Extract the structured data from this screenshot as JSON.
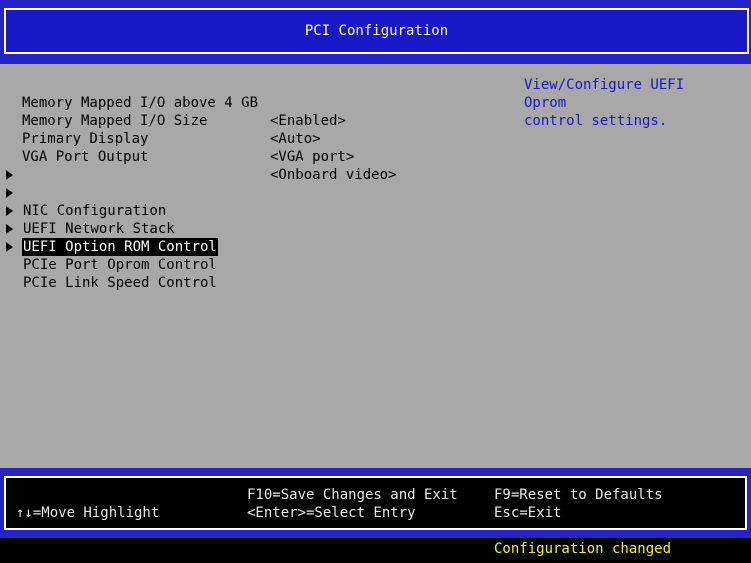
{
  "header": {
    "title": "PCI Configuration"
  },
  "settings": [
    {
      "label": "Memory Mapped I/O above 4 GB",
      "value": "<Enabled>"
    },
    {
      "label": "Memory Mapped I/O Size",
      "value": "<Auto>"
    },
    {
      "label": "Primary Display",
      "value": "<VGA port>"
    },
    {
      "label": "VGA Port Output",
      "value": "<Onboard video>"
    }
  ],
  "submenus": [
    {
      "label": "NIC Configuration",
      "selected": false
    },
    {
      "label": "UEFI Network Stack",
      "selected": false
    },
    {
      "label": "UEFI Option ROM Control",
      "selected": true
    },
    {
      "label": "PCIe Port Oprom Control",
      "selected": false
    },
    {
      "label": "PCIe Link Speed Control",
      "selected": false
    }
  ],
  "help": {
    "text": "View/Configure UEFI Oprom\ncontrol settings."
  },
  "footer": {
    "move_highlight": "↑↓=Move Highlight",
    "save_exit": "F10=Save Changes and Exit",
    "select_entry": "<Enter>=Select Entry",
    "reset_defaults": "F9=Reset to Defaults",
    "esc_exit": "Esc=Exit"
  },
  "status": {
    "message": "Configuration changed"
  },
  "colors": {
    "frame_blue": "#2424c8",
    "panel_gray": "#a8a8a8",
    "help_blue": "#1818c8",
    "status_yellow": "#f8f800"
  }
}
